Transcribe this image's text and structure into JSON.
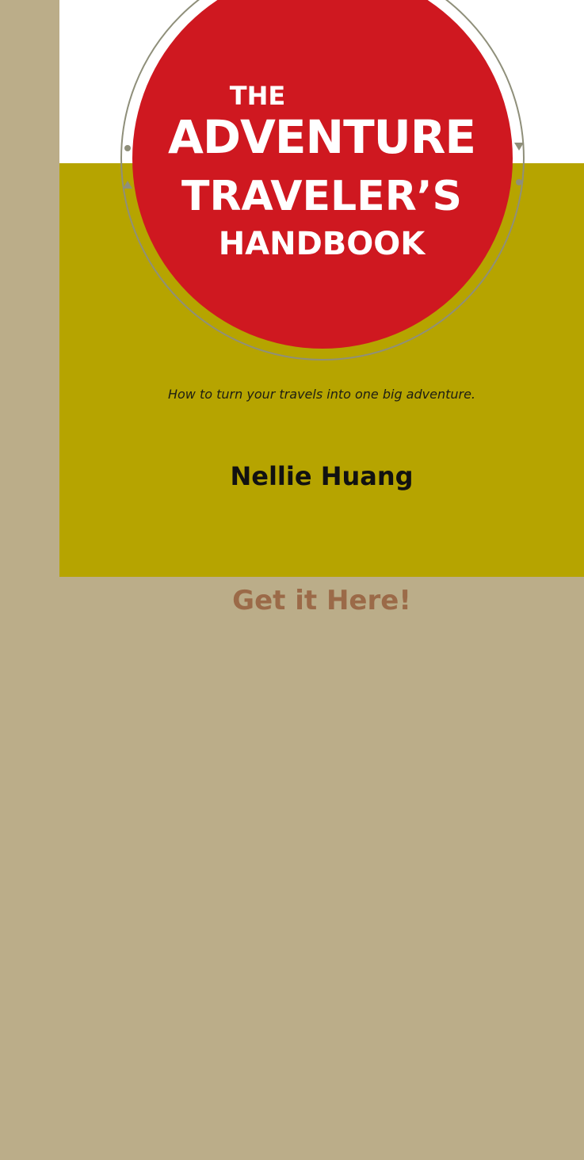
{
  "cover": {
    "title_line_1": "THE",
    "title_line_2": "ADVENTURE",
    "title_line_3": "TRAVELER’S",
    "title_line_4": "HANDBOOK",
    "tagline": "How to turn your travels into one big adventure.",
    "author": "Nellie Huang"
  },
  "cta": {
    "label": "Get it Here!"
  },
  "colors": {
    "page_background": "#bbad89",
    "cover_olive": "#b6a400",
    "cover_red": "#cf1820",
    "cover_top": "#ffffff",
    "link": "#9b6a48"
  }
}
